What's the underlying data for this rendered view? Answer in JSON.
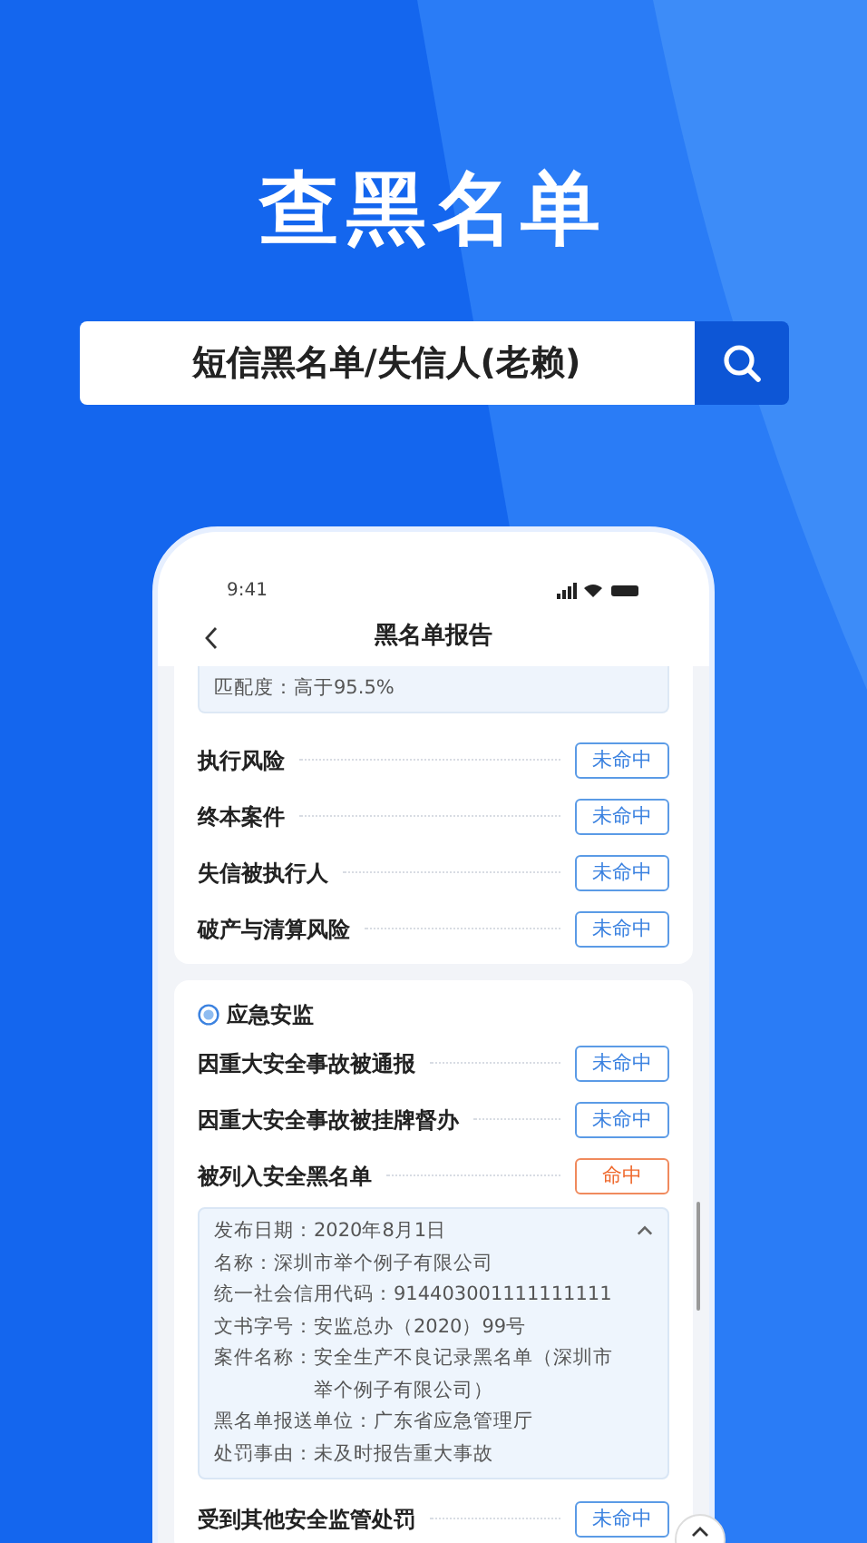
{
  "headline": "查黑名单",
  "search": {
    "value": "短信黑名单/失信人(老赖)"
  },
  "phone": {
    "status_time": "9:41",
    "nav_title": "黑名单报告",
    "sections": [
      {
        "note": "匹配度：高于95.5%",
        "rows": [
          {
            "label": "执行风险",
            "status": "未命中",
            "hit": false
          },
          {
            "label": "终本案件",
            "status": "未命中",
            "hit": false
          },
          {
            "label": "失信被执行人",
            "status": "未命中",
            "hit": false
          },
          {
            "label": "破产与清算风险",
            "status": "未命中",
            "hit": false
          }
        ]
      },
      {
        "title": "应急安监",
        "rows": [
          {
            "label": "因重大安全事故被通报",
            "status": "未命中",
            "hit": false
          },
          {
            "label": "因重大安全事故被挂牌督办",
            "status": "未命中",
            "hit": false
          },
          {
            "label": "被列入安全黑名单",
            "status": "命中",
            "hit": true,
            "details": {
              "expanded": true,
              "fields": [
                {
                  "label": "发布日期：",
                  "value": "2020年8月1日"
                },
                {
                  "label": "名称：",
                  "value": "深圳市举个例子有限公司"
                },
                {
                  "label": "统一社会信用代码：",
                  "value": "914403001111111111"
                },
                {
                  "label": "文书字号：",
                  "value": "安监总办（2020）99号"
                },
                {
                  "label": "案件名称：",
                  "value": "安全生产不良记录黑名单（深圳市举个例子有限公司）"
                },
                {
                  "label": "黑名单报送单位：",
                  "value": "广东省应急管理厅"
                },
                {
                  "label": "处罚事由：",
                  "value": "未及时报告重大事故"
                }
              ]
            }
          },
          {
            "label": "受到其他安全监管处罚",
            "status": "未命中",
            "hit": false
          }
        ]
      }
    ]
  }
}
